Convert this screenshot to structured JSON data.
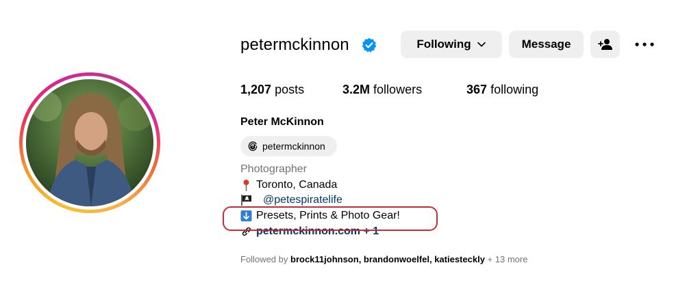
{
  "profile": {
    "username": "petermckinnon",
    "full_name": "Peter McKinnon",
    "verified": true
  },
  "actions": {
    "following_label": "Following",
    "message_label": "Message"
  },
  "stats": {
    "posts_count": "1,207",
    "posts_label": "posts",
    "followers_count": "3.2M",
    "followers_label": "followers",
    "following_count": "367",
    "following_label": "following"
  },
  "threads": {
    "handle": "petermckinnon"
  },
  "bio": {
    "category": "Photographer",
    "location": "Toronto, Canada",
    "pirate_handle": "@petespiratelife",
    "presets": "Presets, Prints & Photo Gear!",
    "link": "petermckinnon.com + 1"
  },
  "followed_by": {
    "prefix": "Followed by",
    "names": "brock11johnson, brandonwoelfel, katiesteckly",
    "more": "+ 13 more"
  },
  "colors": {
    "verified_blue": "#0095f6",
    "button_bg": "#efefef",
    "secondary_text": "#737373",
    "link_text": "#00376b",
    "highlight_red": "#c92a36"
  },
  "icons": [
    "verified-badge-icon",
    "chevron-down-icon",
    "add-user-icon",
    "more-options-icon",
    "threads-icon",
    "pushpin-icon",
    "pirate-flag-icon",
    "down-arrow-icon",
    "link-icon"
  ]
}
